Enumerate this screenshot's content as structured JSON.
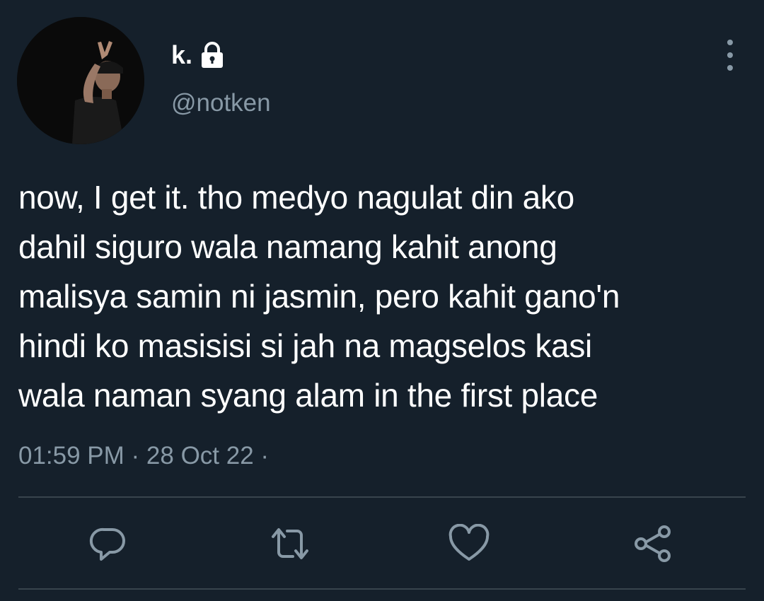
{
  "tweet": {
    "author": {
      "display_name": "k.",
      "handle": "@notken",
      "protected_icon": "lock-icon",
      "avatar": "profile-photo"
    },
    "more_icon": "more-vertical-icon",
    "text": "now, I get it. tho medyo nagulat din ako\ndahil siguro wala namang kahit anong\nmalisya samin ni jasmin, pero kahit gano'n\nhindi ko masisisi si jah na magselos kasi\nwala naman syang alam in the first place",
    "meta": "01:59 PM · 28 Oct 22 ·",
    "actions": [
      {
        "name": "reply",
        "icon": "reply-icon"
      },
      {
        "name": "retweet",
        "icon": "retweet-icon"
      },
      {
        "name": "like",
        "icon": "heart-icon"
      },
      {
        "name": "share",
        "icon": "share-icon"
      }
    ]
  },
  "colors": {
    "background": "#15202b",
    "primary_text": "#ffffff",
    "secondary_text": "#8899a6",
    "divider": "#38444d"
  }
}
